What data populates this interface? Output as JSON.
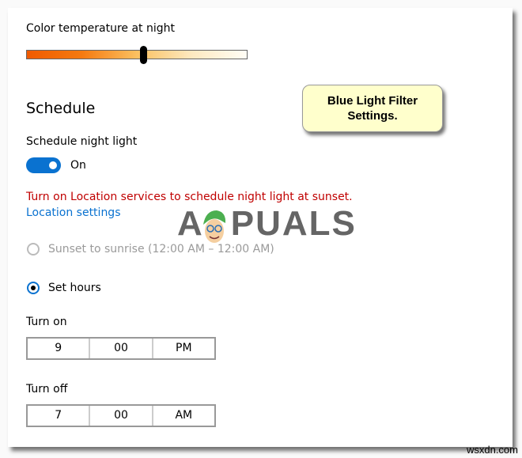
{
  "color_temperature": {
    "label": "Color temperature at night",
    "value_fraction": 0.53,
    "gradient_colors": [
      "#f05a00",
      "#fbc060",
      "#fffdf5"
    ]
  },
  "callout": {
    "line1": "Blue Light Filter",
    "line2": "Settings."
  },
  "schedule": {
    "heading": "Schedule",
    "night_light_label": "Schedule night light",
    "toggle_state": "On",
    "toggle_on": true,
    "warning": "Turn on Location services to schedule night light at sunset.",
    "location_link": "Location settings",
    "options": [
      {
        "label": "Sunset to sunrise (12:00 AM – 12:00 AM)",
        "selected": false,
        "disabled": true
      },
      {
        "label": "Set hours",
        "selected": true,
        "disabled": false
      }
    ]
  },
  "turn_on": {
    "label": "Turn on",
    "hour": "9",
    "minute": "00",
    "period": "PM"
  },
  "turn_off": {
    "label": "Turn off",
    "hour": "7",
    "minute": "00",
    "period": "AM"
  },
  "watermark": {
    "left": "A",
    "right": "PUALS"
  },
  "credit": "wsxdn.com",
  "colors": {
    "accent": "#0a72d0",
    "warning": "#c00000",
    "callout_bg": "#ffffcc"
  }
}
